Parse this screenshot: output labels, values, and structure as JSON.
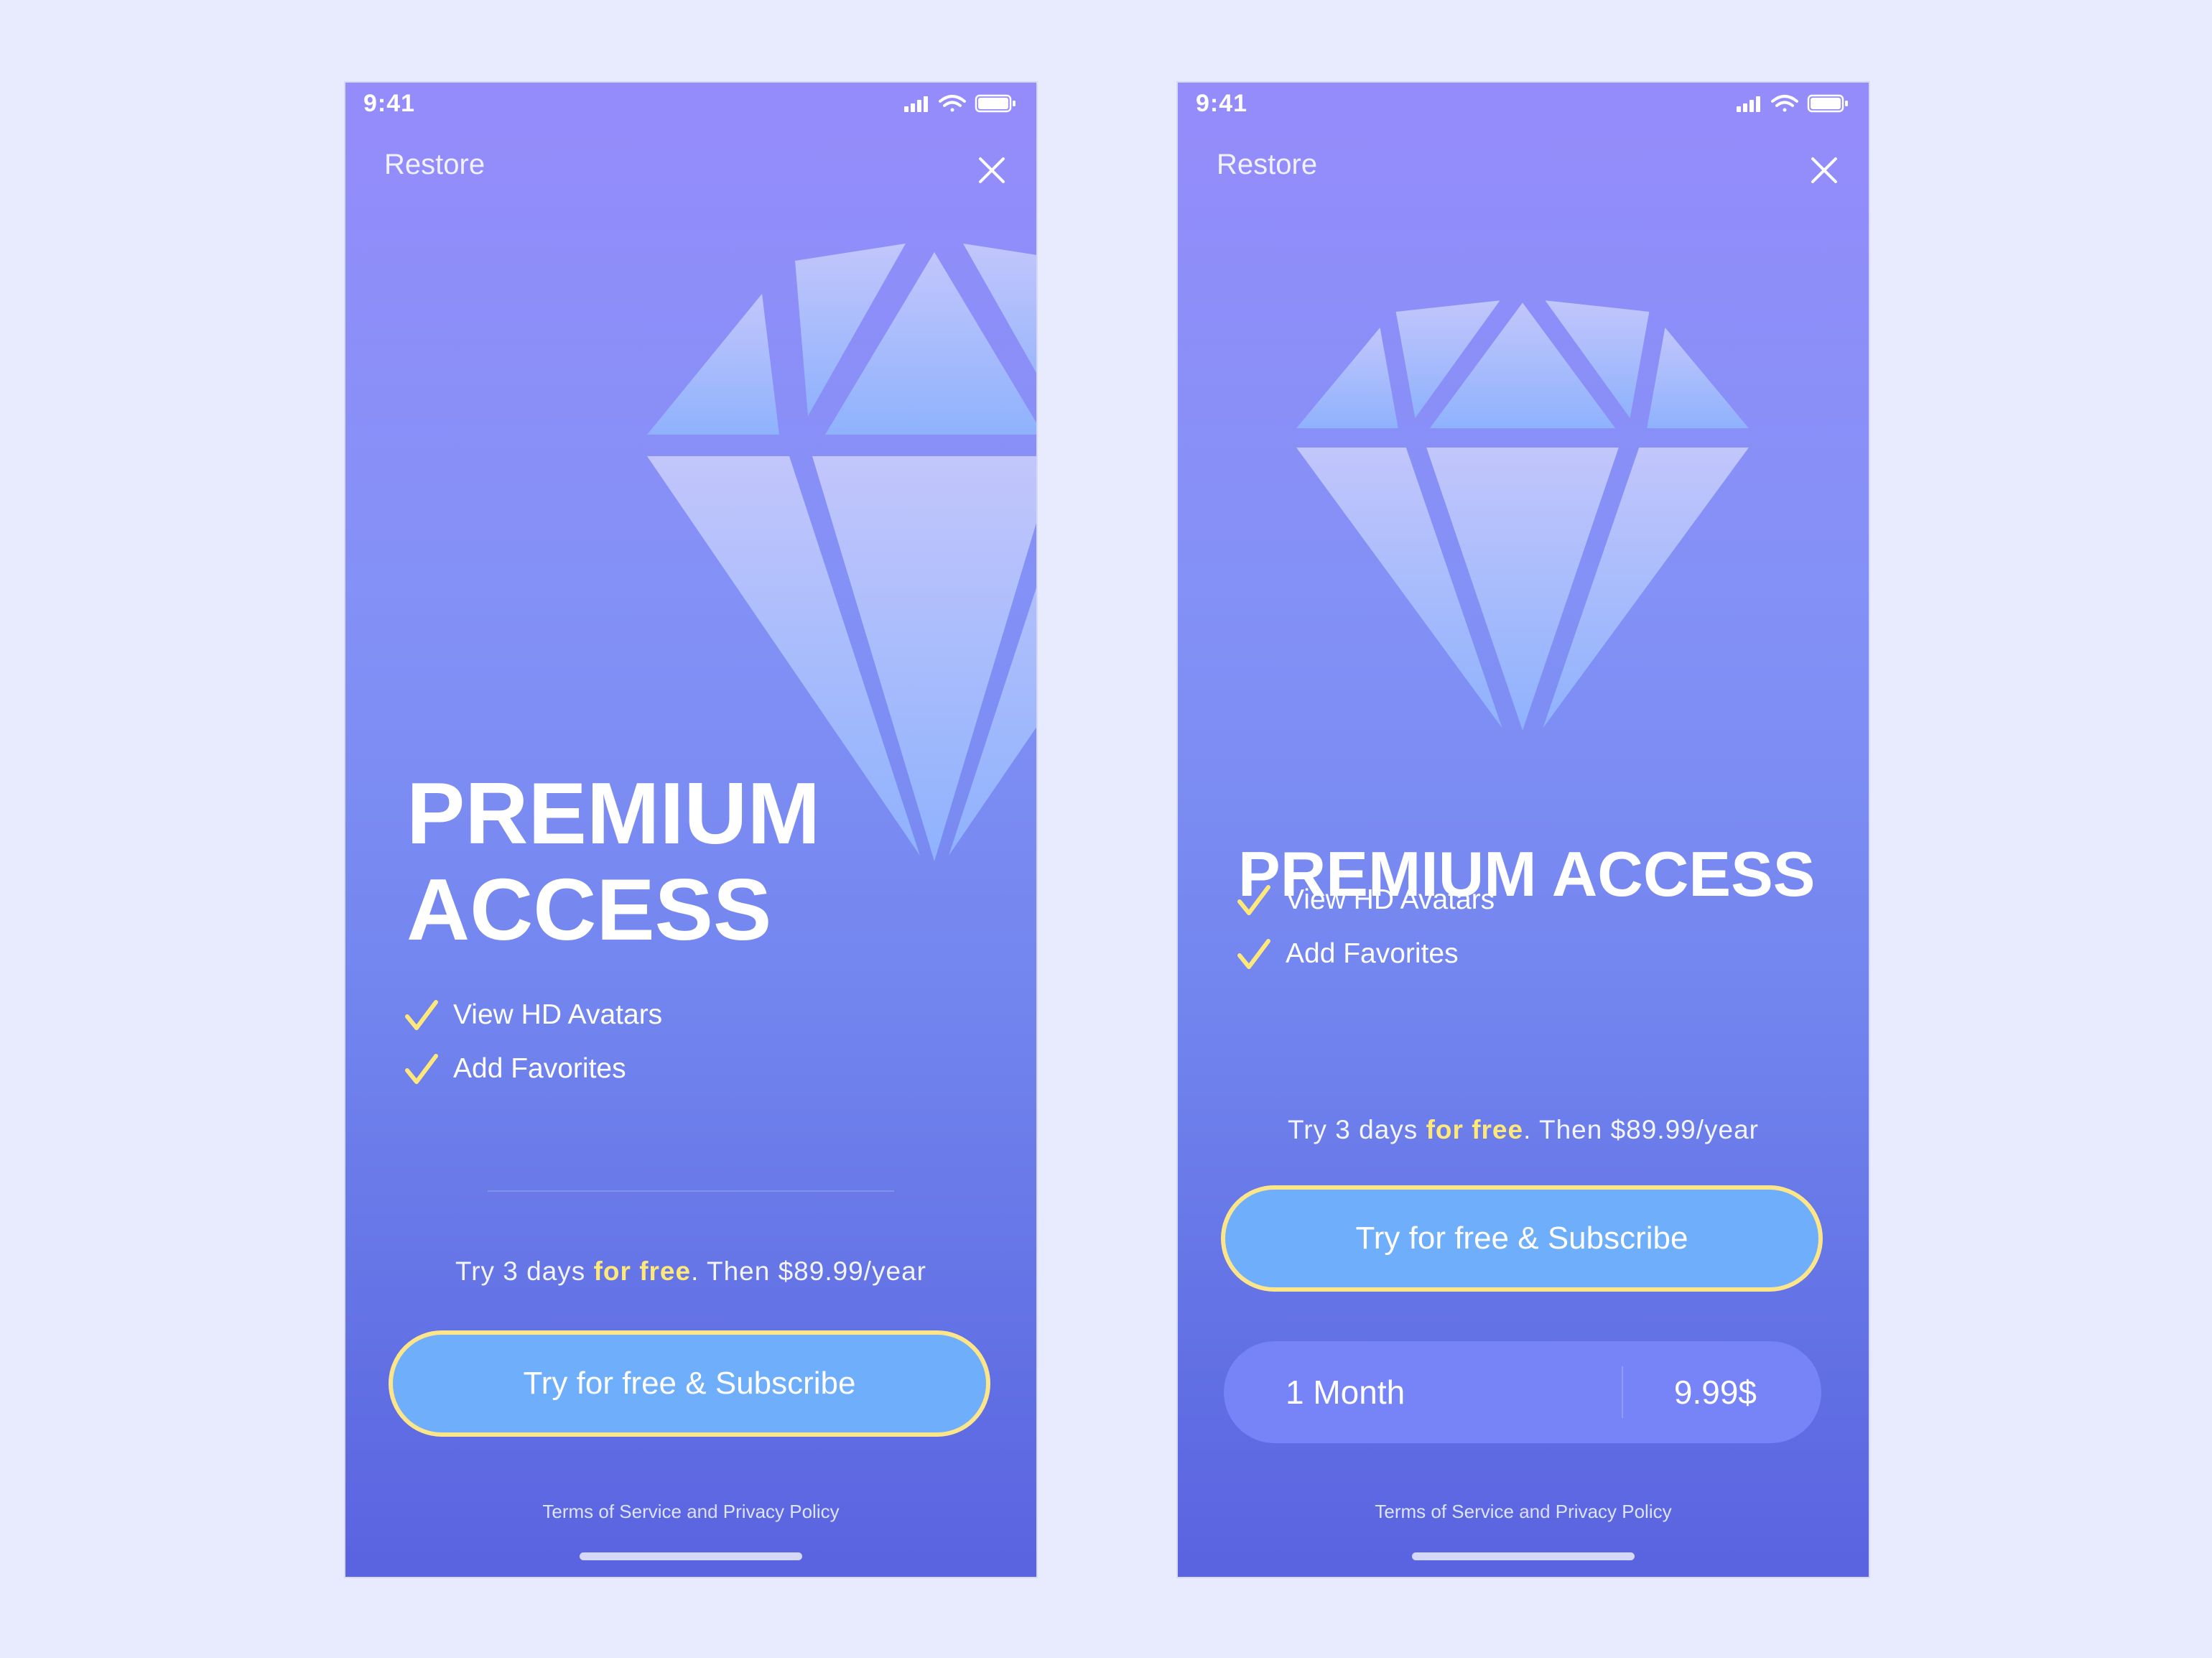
{
  "colors": {
    "background": "#e8ebfe",
    "gradient_top": "#958cfb",
    "gradient_bottom": "#5a63e0",
    "accent_yellow": "#ffe87a",
    "button_fill": "#6eaefa",
    "button_border": "#fde68a"
  },
  "screens": [
    {
      "status_bar": {
        "time": "9:41",
        "icons": [
          "signal-icon",
          "wifi-icon",
          "battery-icon"
        ]
      },
      "header": {
        "restore_label": "Restore",
        "close_icon": "close-icon"
      },
      "hero_icon": "diamond-icon",
      "title": "PREMIUM ACCESS",
      "features": [
        {
          "icon": "check-icon",
          "label": "View HD Avatars"
        },
        {
          "icon": "check-icon",
          "label": "Add Favorites"
        }
      ],
      "trial": {
        "prefix": "Try 3 days ",
        "highlight": "for free",
        "suffix": ". Then $89.99/year"
      },
      "cta_label": "Try for free & Subscribe",
      "legal": {
        "terms": "Terms of Service",
        "and": " and ",
        "privacy": "Privacy Policy"
      }
    },
    {
      "status_bar": {
        "time": "9:41",
        "icons": [
          "signal-icon",
          "wifi-icon",
          "battery-icon"
        ]
      },
      "header": {
        "restore_label": "Restore",
        "close_icon": "close-icon"
      },
      "hero_icon": "diamond-icon",
      "title": "PREMIUM ACCESS",
      "features": [
        {
          "icon": "check-icon",
          "label": "View HD Avatars"
        },
        {
          "icon": "check-icon",
          "label": "Add Favorites"
        }
      ],
      "trial": {
        "prefix": "Try 3 days ",
        "highlight": "for free",
        "suffix": ". Then $89.99/year"
      },
      "cta_label": "Try for free & Subscribe",
      "plan": {
        "name": "1 Month",
        "price": "9.99$"
      },
      "legal": {
        "terms": "Terms of Service",
        "and": " and ",
        "privacy": "Privacy Policy"
      }
    }
  ]
}
